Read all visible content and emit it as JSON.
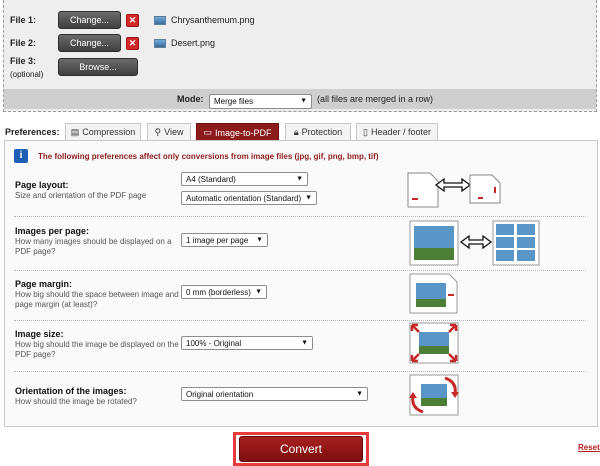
{
  "files": [
    {
      "label": "File 1:",
      "button": "Change...",
      "delete_icon": "close-icon",
      "filename": "Chrysanthemum.png"
    },
    {
      "label": "File 2:",
      "button": "Change...",
      "delete_icon": "close-icon",
      "filename": "Desert.png"
    },
    {
      "label": "File 3:",
      "sublabel": "(optional)",
      "button": "Browse..."
    }
  ],
  "mode": {
    "label": "Mode:",
    "value": "Merge files",
    "note": "(all files are merged in a row)"
  },
  "preferences": {
    "label": "Preferences:",
    "tabs": [
      {
        "label": "Compression",
        "icon": "compress-icon",
        "active": false
      },
      {
        "label": "View",
        "icon": "magnifier-icon",
        "active": false
      },
      {
        "label": "Image-to-PDF",
        "icon": "image-icon",
        "active": true
      },
      {
        "label": "Protection",
        "icon": "lock-icon",
        "active": false
      },
      {
        "label": "Header / footer",
        "icon": "page-icon",
        "active": false
      }
    ],
    "info": "The following preferences affect only conversions from image files (jpg, gif, png, bmp, tif)",
    "page_layout": {
      "title": "Page layout:",
      "desc": "Size and orientation of the PDF page",
      "size": "A4 (Standard)",
      "orientation": "Automatic orientation (Standard)"
    },
    "images_per_page": {
      "title": "Images per page:",
      "desc": "How many images should be displayed on a PDF page?",
      "value": "1 image per page"
    },
    "page_margin": {
      "title": "Page margin:",
      "desc": "How big should the space between image and page margin (at least)?",
      "value": "0 mm (borderless)"
    },
    "image_size": {
      "title": "Image size:",
      "desc": "How big should the image be displayed on the PDF page?",
      "value": "100% - Original"
    },
    "orientation": {
      "title": "Orientation of the images:",
      "desc": "How should the image be rotated?",
      "value": "Original orientation"
    }
  },
  "convert": "Convert",
  "reset": "Reset",
  "colors": {
    "accent": "#8e1b1b",
    "highlight": "#e83b3b",
    "info": "#1e5fb3"
  }
}
